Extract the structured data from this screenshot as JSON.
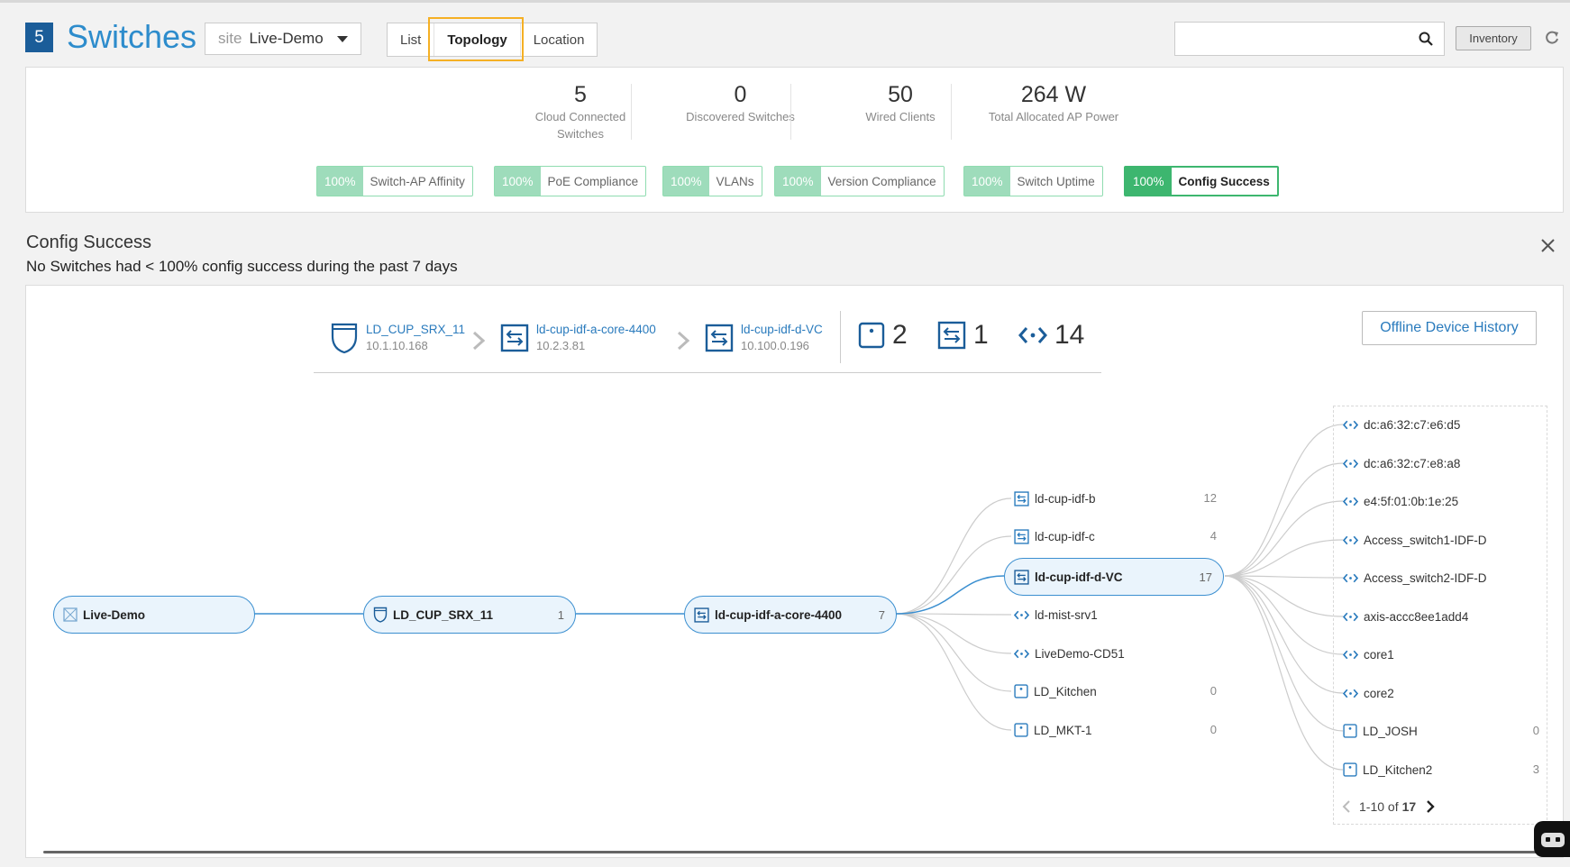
{
  "header": {
    "count": "5",
    "title": "Switches",
    "site_label": "site",
    "site_value": "Live-Demo",
    "tabs": [
      "List",
      "Topology",
      "Location"
    ],
    "active_tab": "Topology",
    "search_placeholder": "",
    "inventory_label": "Inventory"
  },
  "stats": [
    {
      "value": "5",
      "label_line1": "Cloud Connected",
      "label_line2": "Switches"
    },
    {
      "value": "0",
      "label_line1": "Discovered Switches",
      "label_line2": ""
    },
    {
      "value": "50",
      "label_line1": "Wired Clients",
      "label_line2": ""
    },
    {
      "value": "264 W",
      "label_line1": "Total Allocated AP Power",
      "label_line2": ""
    }
  ],
  "sle_chips": [
    {
      "pct": "100%",
      "name": "Switch-AP Affinity"
    },
    {
      "pct": "100%",
      "name": "PoE Compliance"
    },
    {
      "pct": "100%",
      "name": "VLANs"
    },
    {
      "pct": "100%",
      "name": "Version Compliance"
    },
    {
      "pct": "100%",
      "name": "Switch Uptime"
    },
    {
      "pct": "100%",
      "name": "Config Success"
    }
  ],
  "detail": {
    "title": "Config Success",
    "subtitle": "No Switches had < 100% config success during the past 7 days"
  },
  "topology": {
    "offline_history_label": "Offline Device History",
    "breadcrumb": [
      {
        "name": "LD_CUP_SRX_11",
        "ip": "10.1.10.168"
      },
      {
        "name": "ld-cup-idf-a-core-4400",
        "ip": "10.2.3.81"
      },
      {
        "name": "ld-cup-idf-d-VC",
        "ip": "10.100.0.196"
      }
    ],
    "counts": {
      "aps": "2",
      "switches": "1",
      "clients": "14"
    },
    "nodes": [
      {
        "name": "Live-Demo",
        "count": ""
      },
      {
        "name": "LD_CUP_SRX_11",
        "count": "1"
      },
      {
        "name": "ld-cup-idf-a-core-4400",
        "count": "7"
      }
    ],
    "middle": [
      {
        "name": "ld-cup-idf-b",
        "count": "12",
        "icon": "switch"
      },
      {
        "name": "ld-cup-idf-c",
        "count": "4",
        "icon": "switch"
      },
      {
        "name": "ld-cup-idf-d-VC",
        "count": "17",
        "icon": "switch"
      },
      {
        "name": "ld-mist-srv1",
        "count": "",
        "icon": "client"
      },
      {
        "name": "LiveDemo-CD51",
        "count": "",
        "icon": "client"
      },
      {
        "name": "LD_Kitchen",
        "count": "0",
        "icon": "ap"
      },
      {
        "name": "LD_MKT-1",
        "count": "0",
        "icon": "ap"
      }
    ],
    "right": [
      {
        "name": "dc:a6:32:c7:e6:d5",
        "count": "",
        "icon": "client"
      },
      {
        "name": "dc:a6:32:c7:e8:a8",
        "count": "",
        "icon": "client"
      },
      {
        "name": "e4:5f:01:0b:1e:25",
        "count": "",
        "icon": "client"
      },
      {
        "name": "Access_switch1-IDF-D",
        "count": "",
        "icon": "client"
      },
      {
        "name": "Access_switch2-IDF-D",
        "count": "",
        "icon": "client"
      },
      {
        "name": "axis-accc8ee1add4",
        "count": "",
        "icon": "client"
      },
      {
        "name": "core1",
        "count": "",
        "icon": "client"
      },
      {
        "name": "core2",
        "count": "",
        "icon": "client"
      },
      {
        "name": "LD_JOSH",
        "count": "0",
        "icon": "ap"
      },
      {
        "name": "LD_Kitchen2",
        "count": "3",
        "icon": "ap"
      }
    ],
    "pager": {
      "range": "1-10 of",
      "total": "17"
    }
  },
  "colors": {
    "brand_blue": "#2d8ccc",
    "badge_blue": "#1b5d99",
    "sle_green": "#3db66f",
    "sle_light_green": "#9edcbb",
    "link_blue": "#2a7bbd",
    "highlight_orange": "#f5b024"
  }
}
